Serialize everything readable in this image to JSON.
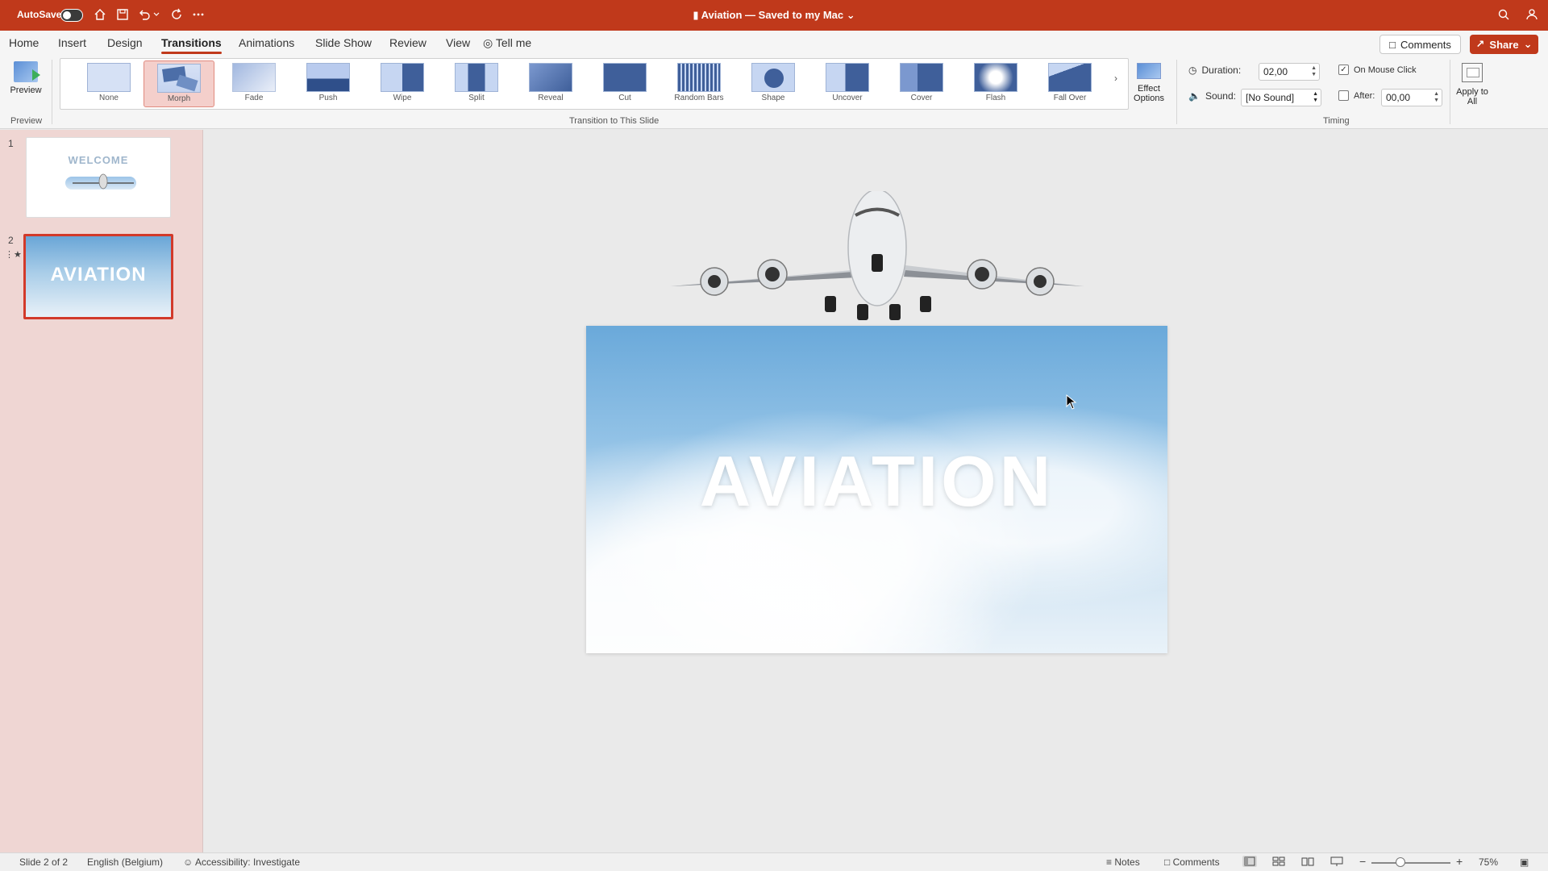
{
  "titlebar": {
    "autosave_label": "AutoSave",
    "autosave_on": false,
    "doc_title": "Aviation — Saved to my Mac",
    "accent": "#c0391b"
  },
  "menu": {
    "tabs": [
      "Home",
      "Insert",
      "Design",
      "Transitions",
      "Animations",
      "Slide Show",
      "Review",
      "View"
    ],
    "active_tab": "Transitions",
    "tell_me": "Tell me",
    "comments_label": "Comments",
    "share_label": "Share"
  },
  "ribbon": {
    "preview_label": "Preview",
    "preview_group": "Preview",
    "transitions_group": "Transition to This Slide",
    "transitions": [
      {
        "label": "None",
        "icon": "none-thumb"
      },
      {
        "label": "Morph",
        "icon": "morph-thumb",
        "selected": true
      },
      {
        "label": "Fade",
        "icon": "fade-thumb"
      },
      {
        "label": "Push",
        "icon": "push-thumb"
      },
      {
        "label": "Wipe",
        "icon": "wipe-thumb"
      },
      {
        "label": "Split",
        "icon": "split-thumb"
      },
      {
        "label": "Reveal",
        "icon": "reveal-thumb"
      },
      {
        "label": "Cut",
        "icon": "cut-thumb"
      },
      {
        "label": "Random Bars",
        "icon": "random-bars-thumb"
      },
      {
        "label": "Shape",
        "icon": "shape-thumb"
      },
      {
        "label": "Uncover",
        "icon": "uncover-thumb"
      },
      {
        "label": "Cover",
        "icon": "cover-thumb"
      },
      {
        "label": "Flash",
        "icon": "flash-thumb"
      },
      {
        "label": "Fall Over",
        "icon": "fall-over-thumb"
      }
    ],
    "effect_options_label": "Effect Options",
    "timing_group": "Timing",
    "duration_label": "Duration:",
    "duration_value": "02,00",
    "sound_label": "Sound:",
    "sound_value": "[No Sound]",
    "on_mouse_click_label": "On Mouse Click",
    "on_mouse_click_checked": true,
    "after_label": "After:",
    "after_value": "00,00",
    "after_checked": false,
    "apply_all_label": "Apply to All"
  },
  "slides": [
    {
      "number": "1",
      "thumb_text": "WELCOME"
    },
    {
      "number": "2",
      "thumb_text": "AVIATION",
      "selected": true,
      "has_animation": true
    }
  ],
  "canvas": {
    "slide_title": "AVIATION"
  },
  "statusbar": {
    "slide_info": "Slide 2 of 2",
    "language": "English (Belgium)",
    "accessibility": "Accessibility: Investigate",
    "notes_label": "Notes",
    "comments_label": "Comments",
    "zoom": "75%"
  }
}
